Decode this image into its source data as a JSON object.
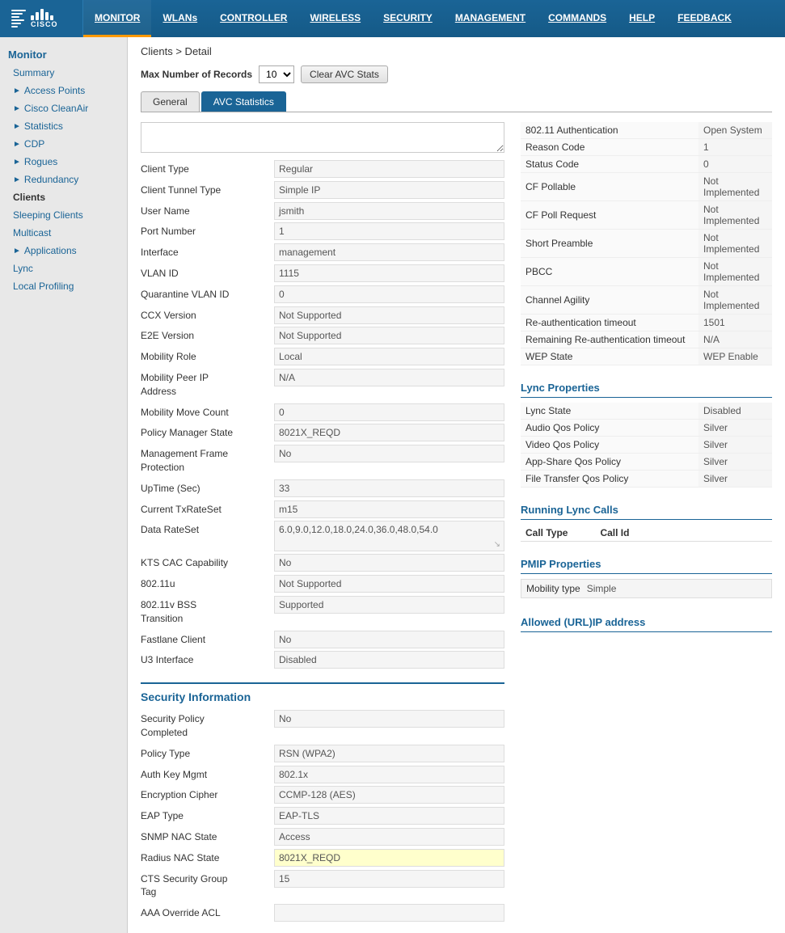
{
  "nav": {
    "items": [
      {
        "label": "MONITOR",
        "active": true,
        "underlined": true
      },
      {
        "label": "WLANs",
        "active": false,
        "underlined": true
      },
      {
        "label": "CONTROLLER",
        "active": false,
        "underlined": true
      },
      {
        "label": "WIRELESS",
        "active": false,
        "underlined": true
      },
      {
        "label": "SECURITY",
        "active": false,
        "underlined": true
      },
      {
        "label": "MANAGEMENT",
        "active": false,
        "underlined": true
      },
      {
        "label": "COMMANDS",
        "active": false,
        "underlined": true
      },
      {
        "label": "HELP",
        "active": false,
        "underlined": true
      },
      {
        "label": "FEEDBACK",
        "active": false,
        "underlined": true
      }
    ],
    "logo_text": "CISCO"
  },
  "sidebar": {
    "section_title": "Monitor",
    "items": [
      {
        "label": "Summary",
        "indent": false,
        "arrow": false,
        "active": false
      },
      {
        "label": "Access Points",
        "indent": false,
        "arrow": true,
        "active": false
      },
      {
        "label": "Cisco CleanAir",
        "indent": false,
        "arrow": true,
        "active": false
      },
      {
        "label": "Statistics",
        "indent": false,
        "arrow": true,
        "active": false
      },
      {
        "label": "CDP",
        "indent": false,
        "arrow": true,
        "active": false
      },
      {
        "label": "Rogues",
        "indent": false,
        "arrow": true,
        "active": false
      },
      {
        "label": "Redundancy",
        "indent": false,
        "arrow": true,
        "active": false
      },
      {
        "label": "Clients",
        "indent": false,
        "arrow": false,
        "active": true
      },
      {
        "label": "Sleeping Clients",
        "indent": false,
        "arrow": false,
        "active": false
      },
      {
        "label": "Multicast",
        "indent": false,
        "arrow": false,
        "active": false
      },
      {
        "label": "Applications",
        "indent": false,
        "arrow": true,
        "active": false
      },
      {
        "label": "Lync",
        "indent": false,
        "arrow": false,
        "active": false
      },
      {
        "label": "Local Profiling",
        "indent": false,
        "arrow": false,
        "active": false
      }
    ]
  },
  "breadcrumb": "Clients > Detail",
  "toolbar": {
    "max_records_label": "Max Number of Records",
    "max_records_value": "10",
    "clear_btn_label": "Clear AVC Stats"
  },
  "tabs": [
    {
      "label": "General",
      "active": false
    },
    {
      "label": "AVC Statistics",
      "active": true
    }
  ],
  "general_fields": [
    {
      "label": "Client Type",
      "value": "Regular"
    },
    {
      "label": "Client Tunnel Type",
      "value": "Simple IP"
    },
    {
      "label": "User Name",
      "value": "jsmith"
    },
    {
      "label": "Port Number",
      "value": "1"
    },
    {
      "label": "Interface",
      "value": "management"
    },
    {
      "label": "VLAN ID",
      "value": "1115"
    },
    {
      "label": "Quarantine VLAN ID",
      "value": "0"
    },
    {
      "label": "CCX Version",
      "value": "Not Supported"
    },
    {
      "label": "E2E Version",
      "value": "Not Supported"
    },
    {
      "label": "Mobility Role",
      "value": "Local"
    },
    {
      "label": "Mobility Peer IP Address",
      "value": "N/A"
    },
    {
      "label": "Mobility Move Count",
      "value": "0"
    },
    {
      "label": "Policy Manager State",
      "value": "8021X_REQD"
    },
    {
      "label": "Management Frame Protection",
      "value": "No"
    },
    {
      "label": "UpTime (Sec)",
      "value": "33"
    },
    {
      "label": "Current TxRateSet",
      "value": "m15"
    },
    {
      "label": "Data RateSet",
      "value": "6.0,9.0,12.0,18.0,24.0,36.0,48.0,54.0",
      "wide": true
    },
    {
      "label": "KTS CAC Capability",
      "value": "No"
    },
    {
      "label": "802.11u",
      "value": "Not Supported"
    },
    {
      "label": "802.11v BSS Transition",
      "value": "Supported"
    },
    {
      "label": "Fastlane Client",
      "value": "No"
    },
    {
      "label": "U3 Interface",
      "value": "Disabled"
    }
  ],
  "right_fields": [
    {
      "label": "802.11 Authentication",
      "value": "Open System"
    },
    {
      "label": "Reason Code",
      "value": "1"
    },
    {
      "label": "Status Code",
      "value": "0"
    },
    {
      "label": "CF Pollable",
      "value": "Not Implemented"
    },
    {
      "label": "CF Poll Request",
      "value": "Not Implemented"
    },
    {
      "label": "Short Preamble",
      "value": "Not Implemented"
    },
    {
      "label": "PBCC",
      "value": "Not Implemented"
    },
    {
      "label": "Channel Agility",
      "value": "Not Implemented"
    },
    {
      "label": "Re-authentication timeout",
      "value": "1501"
    },
    {
      "label": "Remaining Re-authentication timeout",
      "value": "N/A"
    },
    {
      "label": "WEP State",
      "value": "WEP Enable"
    }
  ],
  "lync_section": {
    "title": "Lync Properties",
    "fields": [
      {
        "label": "Lync State",
        "value": "Disabled"
      },
      {
        "label": "Audio Qos Policy",
        "value": "Silver"
      },
      {
        "label": "Video Qos Policy",
        "value": "Silver"
      },
      {
        "label": "App-Share Qos Policy",
        "value": "Silver"
      },
      {
        "label": "File Transfer Qos Policy",
        "value": "Silver"
      }
    ]
  },
  "running_lync": {
    "title": "Running Lync Calls",
    "col1": "Call Type",
    "col2": "Call Id"
  },
  "pmip": {
    "title": "PMIP Properties",
    "label": "Mobility type",
    "value": "Simple"
  },
  "allowed_ip": {
    "title": "Allowed (URL)IP address"
  },
  "security_section": {
    "title": "Security Information",
    "fields": [
      {
        "label": "Security Policy Completed",
        "value": "No"
      },
      {
        "label": "Policy Type",
        "value": "RSN (WPA2)"
      },
      {
        "label": "Auth Key Mgmt",
        "value": "802.1x"
      },
      {
        "label": "Encryption Cipher",
        "value": "CCMP-128 (AES)"
      },
      {
        "label": "EAP Type",
        "value": "EAP-TLS"
      },
      {
        "label": "SNMP NAC State",
        "value": "Access"
      },
      {
        "label": "Radius NAC State",
        "value": "8021X_REQD"
      },
      {
        "label": "CTS Security Group Tag",
        "value": "15"
      },
      {
        "label": "AAA Override ACL",
        "value": ""
      }
    ]
  }
}
